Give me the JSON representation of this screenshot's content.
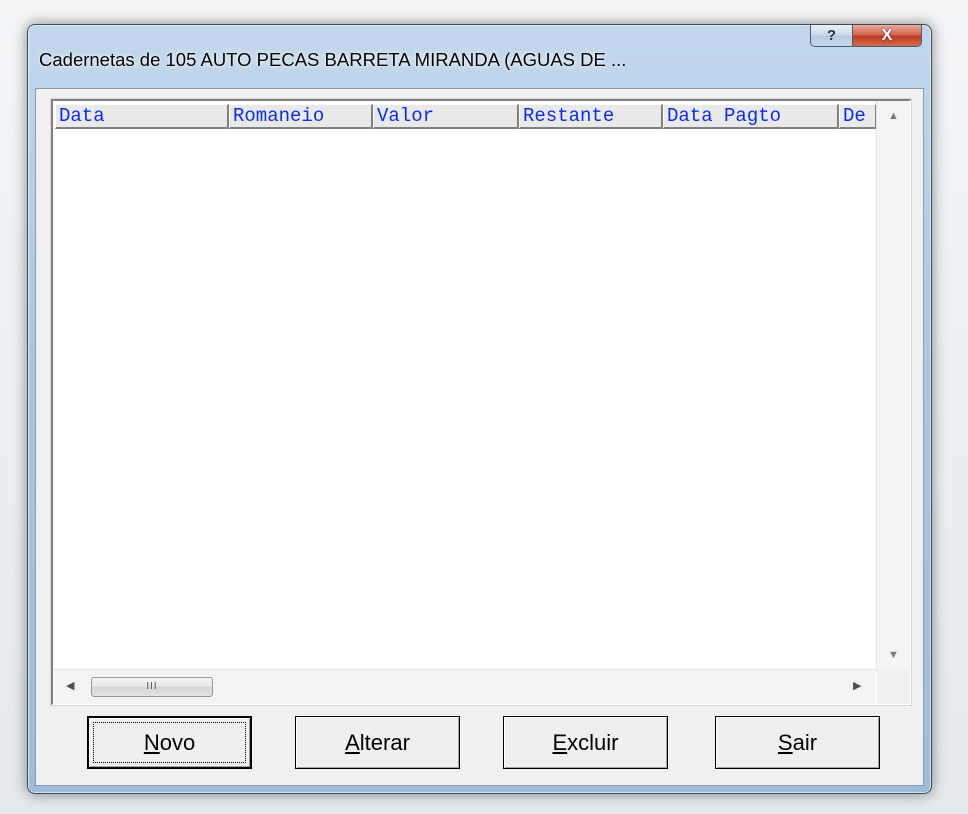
{
  "window": {
    "title": "Cadernetas de 105 AUTO PECAS BARRETA MIRANDA (AGUAS DE ...",
    "help_glyph": "?",
    "close_glyph": "X"
  },
  "grid": {
    "columns": [
      "Data",
      "Romaneio",
      "Valor",
      "Restante",
      "Data Pagto",
      "De"
    ],
    "rows": [],
    "hscroll_thumb_glyph": "III"
  },
  "buttons": {
    "novo": {
      "accel": "N",
      "rest": "ovo"
    },
    "alterar": {
      "accel": "A",
      "rest": "lterar"
    },
    "excluir": {
      "accel": "E",
      "rest": "xcluir"
    },
    "sair": {
      "accel": "S",
      "rest": "air"
    }
  },
  "colors": {
    "header_text": "#0b2cf0",
    "close_button": "#c2391f"
  }
}
